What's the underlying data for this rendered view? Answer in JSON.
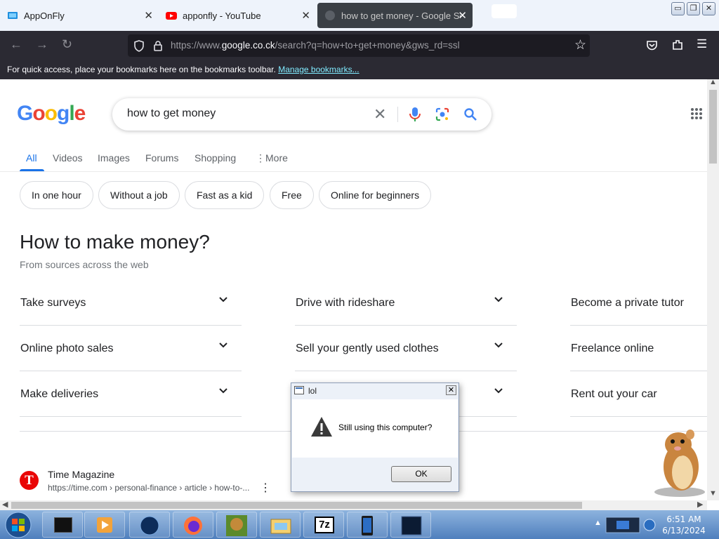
{
  "tabs": [
    {
      "title": "AppOnFly"
    },
    {
      "title": "apponfly - YouTube"
    },
    {
      "title": "how to get money - Google Se"
    }
  ],
  "window_controls": {
    "minimize": "▭",
    "restore": "❐",
    "close": "✕"
  },
  "navbar": {
    "url_prefix": "https://www.",
    "url_domain": "google.co.ck",
    "url_suffix": "/search?q=how+to+get+money&gws_rd=ssl"
  },
  "bookmarks": {
    "message": "For quick access, place your bookmarks here on the bookmarks toolbar.",
    "manage_link": "Manage bookmarks..."
  },
  "google": {
    "logo": [
      "G",
      "o",
      "o",
      "g",
      "l",
      "e"
    ],
    "logo_colors": [
      "#4285f4",
      "#ea4335",
      "#fbbc05",
      "#4285f4",
      "#34a853",
      "#ea4335"
    ],
    "query": "how to get money",
    "tabs": [
      "All",
      "Videos",
      "Images",
      "Forums",
      "Shopping",
      "More"
    ],
    "chips": [
      "In one hour",
      "Without a job",
      "Fast as a kid",
      "Free",
      "Online for beginners"
    ],
    "heading": "How to make money?",
    "subheading": "From sources across the web",
    "ideas": [
      "Take surveys",
      "Drive with rideshare",
      "Become a private tutor",
      "Online photo sales",
      "Sell your gently used clothes",
      "Freelance online",
      "Make deliveries",
      "",
      "Rent out your car"
    ],
    "result": {
      "site": "Time Magazine",
      "url": "https://time.com › personal-finance › article › how-to-...",
      "icon_letter": "T"
    }
  },
  "dialog": {
    "title": "lol",
    "message": "Still using this computer?",
    "ok": "OK"
  },
  "taskbar": {
    "time": "6:51 AM",
    "date": "6/13/2024",
    "seven_zip_label": "7z"
  },
  "colors": {
    "accent_blue": "#1a73e8",
    "browser_dark": "#2b2a33",
    "taskbar": "#4f7fbd"
  }
}
